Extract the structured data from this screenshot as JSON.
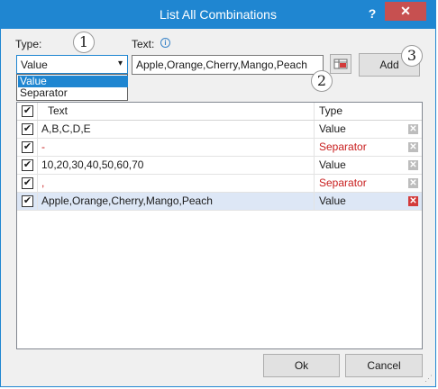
{
  "window": {
    "title": "List All Combinations",
    "help": "?",
    "close": "✕"
  },
  "form": {
    "type_label": "Type:",
    "type_value": "Value",
    "type_options": [
      "Value",
      "Separator"
    ],
    "text_label": "Text:",
    "text_value": "Apple,Orange,Cherry,Mango,Peach",
    "add_label": "Add"
  },
  "callouts": [
    "1",
    "2",
    "3"
  ],
  "grid": {
    "headers": {
      "text": "Text",
      "type": "Type"
    },
    "rows": [
      {
        "checked": true,
        "text": "A,B,C,D,E",
        "type": "Value"
      },
      {
        "checked": true,
        "text": "-",
        "type": "Separator"
      },
      {
        "checked": true,
        "text": "10,20,30,40,50,60,70",
        "type": "Value"
      },
      {
        "checked": true,
        "text": ",",
        "type": "Separator"
      },
      {
        "checked": true,
        "text": "Apple,Orange,Cherry,Mango,Peach",
        "type": "Value"
      }
    ],
    "selected_row": 4
  },
  "buttons": {
    "ok": "Ok",
    "cancel": "Cancel"
  },
  "icons": {
    "help": "help-icon",
    "close": "close-icon",
    "info": "info-icon",
    "chevron": "chevron-down-icon",
    "pick": "range-picker-icon",
    "delete": "delete-icon",
    "check": "checkmark-icon"
  },
  "colors": {
    "accent": "#1f86d1",
    "separator_text": "#c81e1e",
    "close_bg": "#c75050",
    "selected_row": "#dde7f6"
  }
}
